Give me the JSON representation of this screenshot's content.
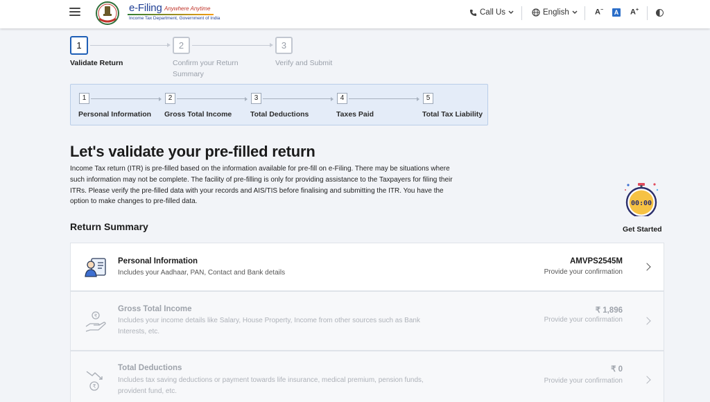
{
  "header": {
    "logo": {
      "brand": "e-Filing",
      "tagline": "Anywhere Anytime",
      "department": "Income Tax Department, Government of India"
    },
    "call_us": "Call Us",
    "language": "English",
    "font_decrease": "A",
    "font_normal": "A",
    "font_increase": "A"
  },
  "stepper": {
    "steps": [
      {
        "number": "1",
        "label": "Validate Return"
      },
      {
        "number": "2",
        "label": "Confirm your Return Summary"
      },
      {
        "number": "3",
        "label": "Verify and Submit"
      }
    ]
  },
  "substeps": [
    {
      "number": "1",
      "label": "Personal Information"
    },
    {
      "number": "2",
      "label": "Gross Total Income"
    },
    {
      "number": "3",
      "label": "Total Deductions"
    },
    {
      "number": "4",
      "label": "Taxes Paid"
    },
    {
      "number": "5",
      "label": "Total Tax Liability"
    }
  ],
  "intro": {
    "title": "Let's validate your pre-filled return",
    "text": "Income Tax return (ITR) is pre-filled based on the information available for pre-fill on e-Filing. There may be situations where such information may not be complete. The facility of pre-filling is only for providing assistance to the Taxpayers for filing their ITRs. Please verify the pre-filled data with your records and AIS/TIS before finalising and submitting the ITR. You have the option to make changes to pre-filled data."
  },
  "timer": {
    "display": "00:00",
    "label": "Get Started"
  },
  "summary": {
    "title": "Return Summary",
    "cards": [
      {
        "title": "Personal Information",
        "description": "Includes your Aadhaar, PAN, Contact and Bank details",
        "value": "AMVPS2545M",
        "status": "Provide your confirmation",
        "icon": "person-id-card-icon"
      },
      {
        "title": "Gross Total Income",
        "description": "Includes your income details like Salary, House Property, Income from other sources such as Bank Interests, etc.",
        "value": "₹ 1,896",
        "status": "Provide your confirmation",
        "icon": "hand-coin-icon"
      },
      {
        "title": "Total Deductions",
        "description": "Includes tax saving deductions or payment towards life insurance, medical premium, pension funds, provident fund, etc.",
        "value": "₹ 0",
        "status": "Provide your confirmation",
        "icon": "falling-coin-icon"
      }
    ]
  },
  "colors": {
    "primary": "#1d5eb6",
    "background": "#f2f4f8",
    "panel": "#e4ecf8",
    "disabled_text": "#9ea3ab"
  }
}
